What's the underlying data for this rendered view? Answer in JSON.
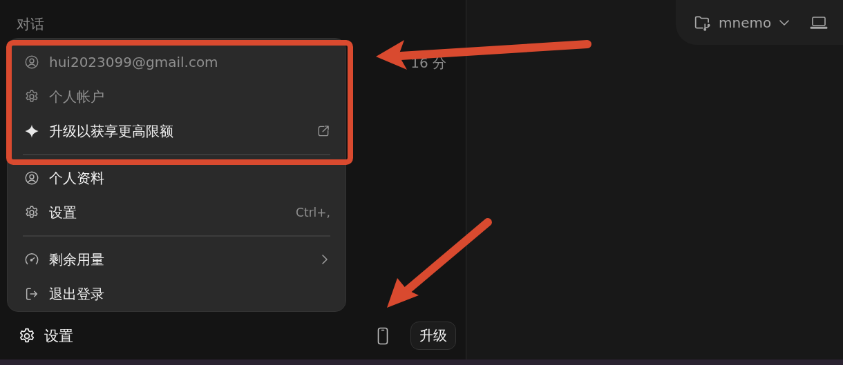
{
  "sidebar": {
    "heading": "对话",
    "time": "16 分",
    "footer": {
      "label": "设置",
      "upgrade_button": "升级"
    }
  },
  "menu": {
    "sections": [
      [
        {
          "kind": "info",
          "label": "hui2023099@gmail.com",
          "disabled": true
        },
        {
          "kind": "info",
          "label": "个人帐户",
          "disabled": true
        },
        {
          "kind": "external",
          "label": "升级以获享更高限额",
          "disabled": false
        }
      ],
      [
        {
          "kind": "action",
          "label": "个人资料",
          "disabled": false
        },
        {
          "kind": "action",
          "label": "设置",
          "shortcut": "Ctrl+,",
          "disabled": false
        }
      ],
      [
        {
          "kind": "submenu",
          "label": "剩余用量",
          "disabled": false
        },
        {
          "kind": "action",
          "label": "退出登录",
          "disabled": false
        }
      ]
    ]
  },
  "toolbar": {
    "project": "mnemo"
  }
}
